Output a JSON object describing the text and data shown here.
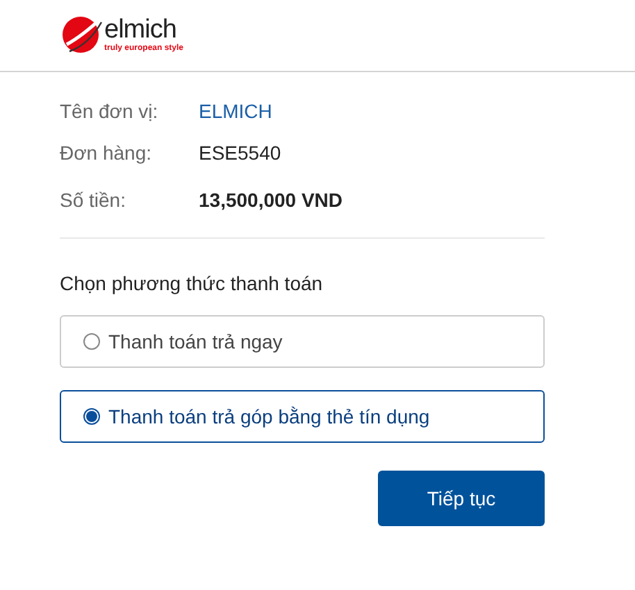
{
  "logo": {
    "name": "elmich",
    "tagline": "truly european style"
  },
  "details": [
    {
      "label": "Tên đơn vị:",
      "value": "ELMICH",
      "kind": "link"
    },
    {
      "label": "Đơn hàng:",
      "value": "ESE5540",
      "kind": "plain"
    },
    {
      "label": "Số tiền:",
      "value": "13,500,000 VND",
      "kind": "amount"
    }
  ],
  "payment": {
    "heading": "Chọn phương thức thanh toán",
    "options": [
      {
        "label": "Thanh toán trả ngay",
        "selected": false
      },
      {
        "label": "Thanh toán trả góp bằng thẻ tín dụng",
        "selected": true
      }
    ]
  },
  "buttons": [
    "Tiếp tục"
  ]
}
